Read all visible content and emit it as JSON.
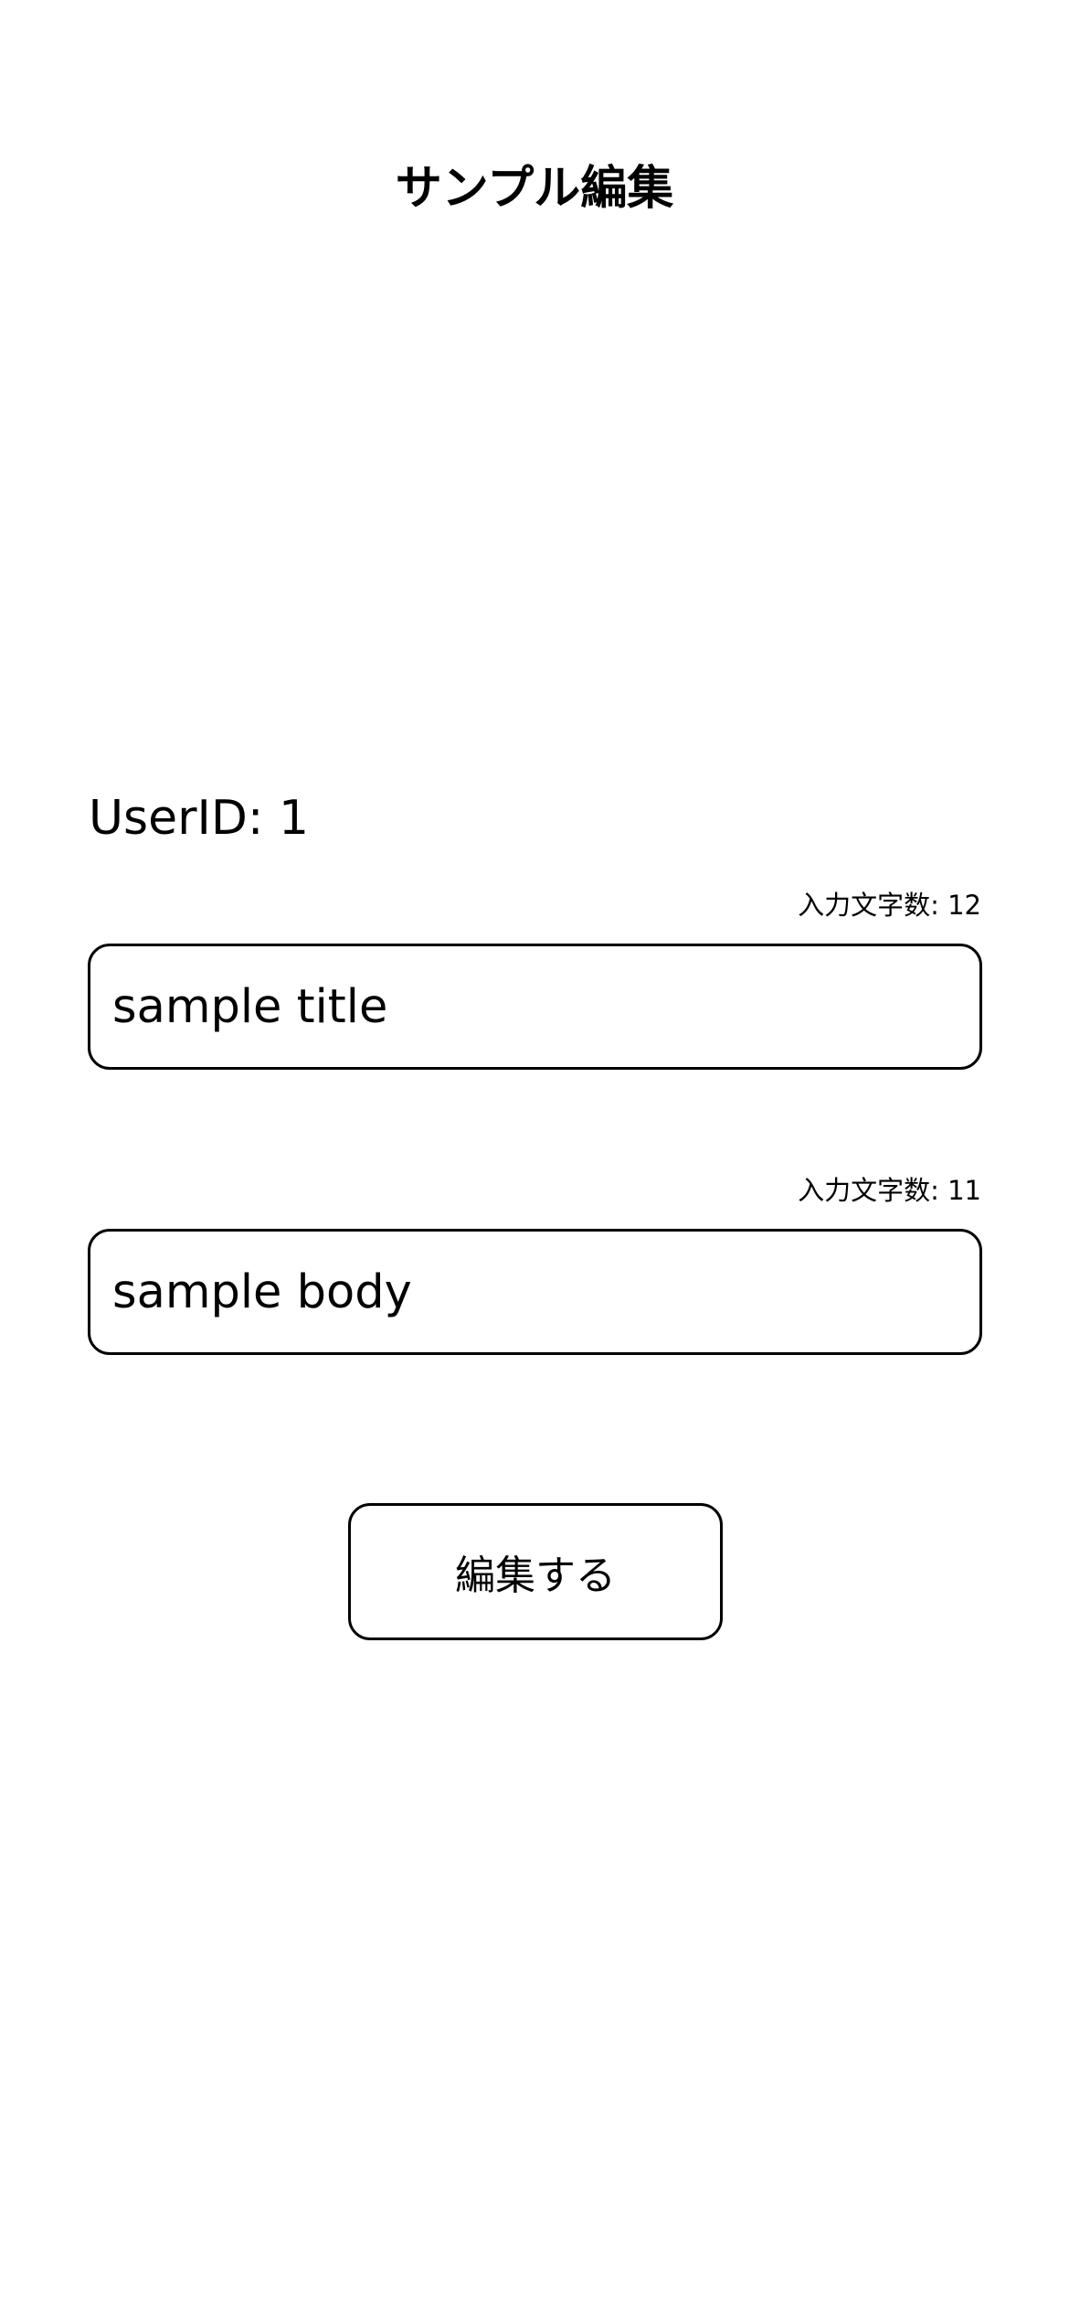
{
  "nav": {
    "title": "サンプル編集"
  },
  "user": {
    "id_label": "UserID: 1"
  },
  "title_field": {
    "char_count": "入力文字数: 12",
    "value": "sample title"
  },
  "body_field": {
    "char_count": "入力文字数: 11",
    "value": "sample body"
  },
  "actions": {
    "edit_label": "編集する"
  }
}
